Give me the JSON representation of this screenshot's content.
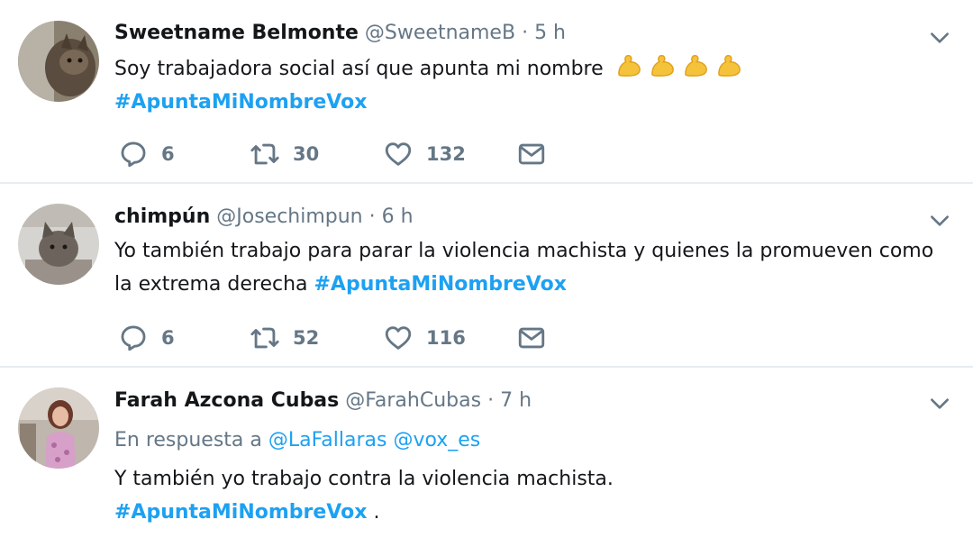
{
  "tweets": [
    {
      "name": "Sweetname Belmonte",
      "handle": "@SweetnameB",
      "time": "5 h",
      "text": "Soy trabajadora social así que apunta mi nombre",
      "emoji": "flexed-biceps-icon ×4",
      "hashtag": "#ApuntaMiNombreVox",
      "replies": "6",
      "retweets": "30",
      "likes": "132"
    },
    {
      "name": "chimpún",
      "handle": "@Josechimpun",
      "time": "6 h",
      "text_line1": "Yo también trabajo para parar la violencia machista y quienes la promueven como",
      "text_line2": "la extrema derecha",
      "hashtag": "#ApuntaMiNombreVox",
      "replies": "6",
      "retweets": "52",
      "likes": "116"
    },
    {
      "name": "Farah Azcona Cubas",
      "handle": "@FarahCubas",
      "time": "7 h",
      "reply_prefix": "En respuesta a",
      "mention1": "@LaFallaras",
      "mention2": "@vox_es",
      "text": "Y también yo trabajo contra la violencia machista.",
      "hashtag": "#ApuntaMiNombreVox",
      "suffix": "."
    }
  ],
  "colors": {
    "link": "#1da1f2",
    "muted": "#657786",
    "text": "#14171a",
    "divider": "#e6ecf0"
  },
  "separator": "·"
}
